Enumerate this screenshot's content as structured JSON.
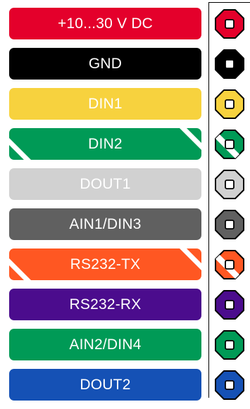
{
  "pins": [
    {
      "label": "+10...30 V DC",
      "color": "#e4002b",
      "striped": false
    },
    {
      "label": "GND",
      "color": "#000000",
      "striped": false
    },
    {
      "label": "DIN1",
      "color": "#f7d23e",
      "striped": false
    },
    {
      "label": "DIN2",
      "color": "#009a56",
      "striped": true
    },
    {
      "label": "DOUT1",
      "color": "#d1d1d1",
      "striped": false
    },
    {
      "label": "AIN1/DIN3",
      "color": "#606060",
      "striped": false
    },
    {
      "label": "RS232-TX",
      "color": "#ff5722",
      "striped": true
    },
    {
      "label": "RS232-RX",
      "color": "#4b0c8d",
      "striped": false
    },
    {
      "label": "AIN2/DIN4",
      "color": "#009a56",
      "striped": false
    },
    {
      "label": "DOUT2",
      "color": "#1551b5",
      "striped": false
    }
  ]
}
